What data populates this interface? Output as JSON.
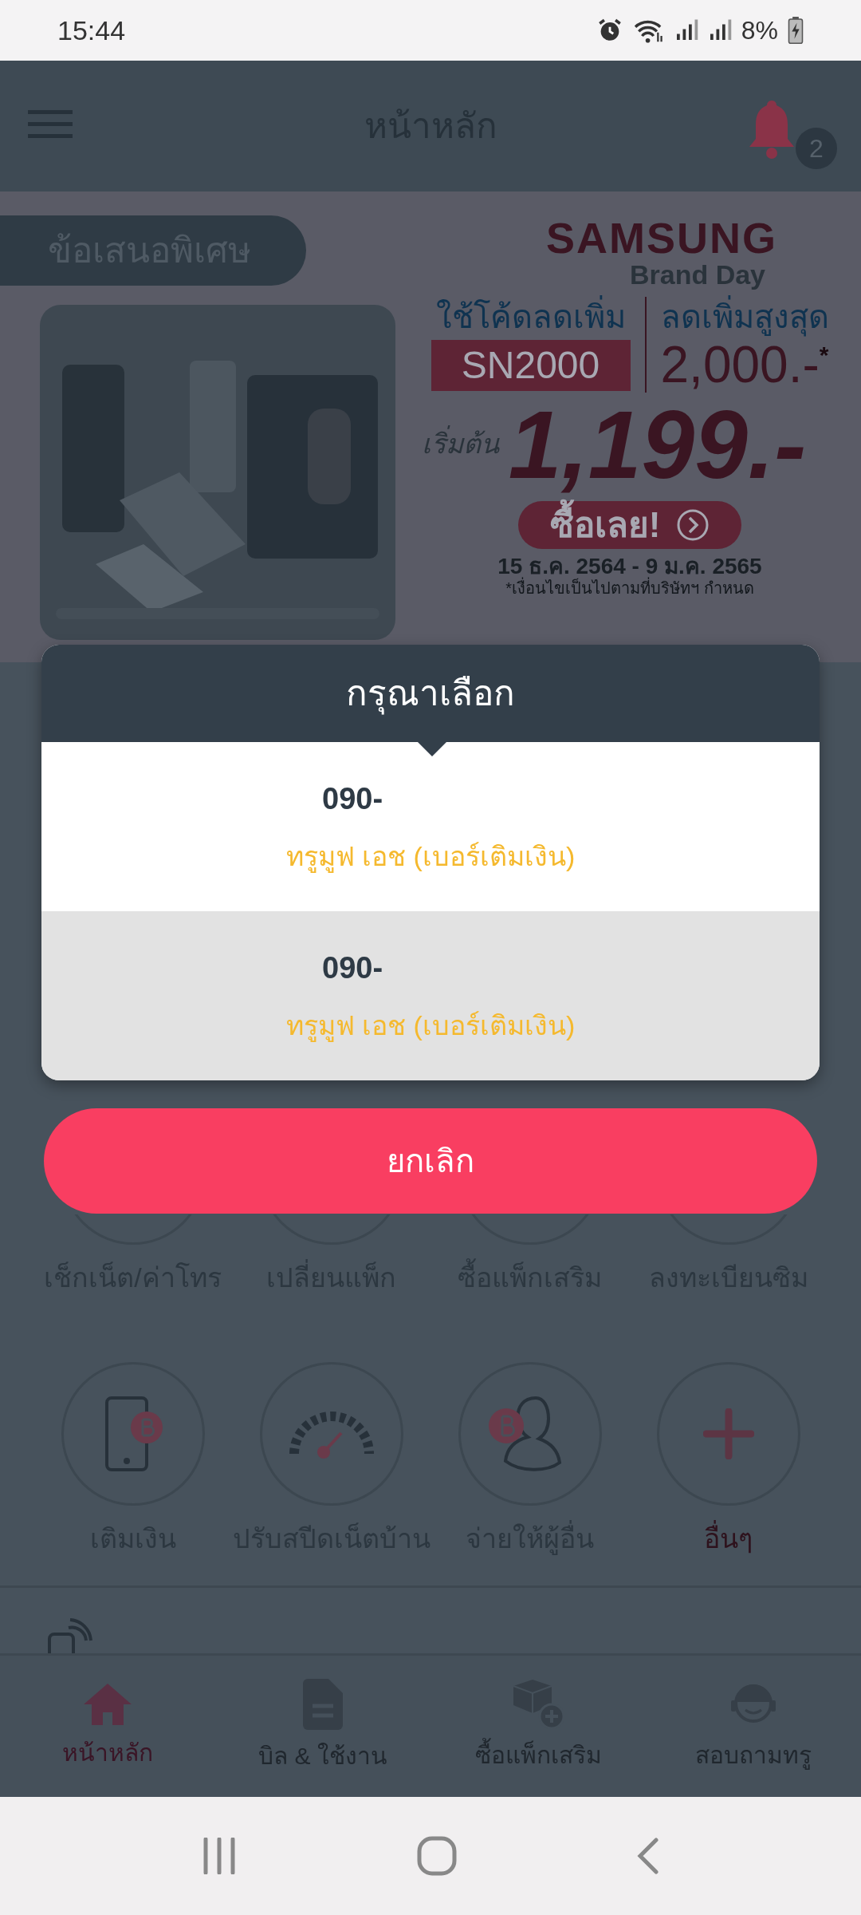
{
  "status_bar": {
    "time": "15:44",
    "battery": "8%"
  },
  "header": {
    "title": "หน้าหลัก",
    "notification_count": "2"
  },
  "banner": {
    "tag": "ข้อเสนอพิเศษ",
    "brand": "SAMSUNG",
    "brand_sub": "Brand Day",
    "code_label": "ใช้โค้ดลดเพิ่ม",
    "code": "SN2000",
    "max_label": "ลดเพิ่มสูงสุด",
    "max_value": "2,000.-",
    "max_mark": "*",
    "price_label": "เริ่มต้น",
    "price": "1,199.-",
    "cta": "ซื้อเลย!",
    "dates": "15 ธ.ค. 2564 - 9 ม.ค. 2565",
    "note": "*เงื่อนไขเป็นไปตามที่บริษัทฯ กำหนด"
  },
  "services": [
    {
      "label": "เช็กเน็ต/ค่าโทร",
      "accent": false
    },
    {
      "label": "เปลี่ยนแพ็ก",
      "accent": false
    },
    {
      "label": "ซื้อแพ็กเสริม",
      "accent": false
    },
    {
      "label": "ลงทะเบียนซิม",
      "accent": false
    },
    {
      "label": "เติมเงิน",
      "kind": "topup",
      "accent": false
    },
    {
      "label": "ปรับสปีดเน็ตบ้าน",
      "kind": "speed",
      "accent": false
    },
    {
      "label": "จ่ายให้ผู้อื่น",
      "kind": "pay",
      "accent": false
    },
    {
      "label": "อื่นๆ",
      "kind": "more",
      "accent": true
    }
  ],
  "bottom_nav": [
    {
      "label": "หน้าหลัก",
      "kind": "home",
      "selected": true
    },
    {
      "label": "บิล & ใช้งาน",
      "kind": "bill",
      "selected": false
    },
    {
      "label": "ซื้อแพ็กเสริม",
      "kind": "addon",
      "selected": false
    },
    {
      "label": "สอบถามทรู",
      "kind": "help",
      "selected": false
    }
  ],
  "dialog": {
    "title": "กรุณาเลือก",
    "options": [
      {
        "number": "090-",
        "plan": "ทรูมูฟ เอช (เบอร์เติมเงิน)",
        "selected": false
      },
      {
        "number": "090-",
        "plan": "ทรูมูฟ เอช (เบอร์เติมเงิน)",
        "selected": true
      }
    ],
    "cancel": "ยกเลิก"
  }
}
